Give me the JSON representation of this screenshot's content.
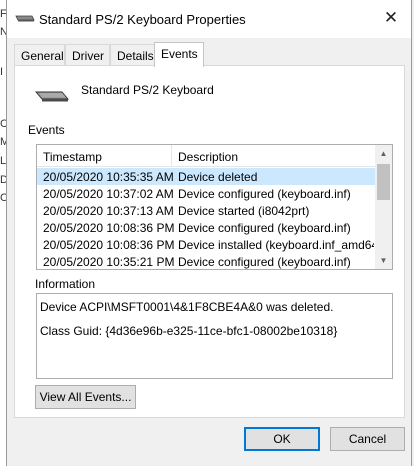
{
  "dialog": {
    "title": "Standard PS/2 Keyboard Properties",
    "close_glyph": "✕"
  },
  "tabs": [
    {
      "label": "General",
      "active": false
    },
    {
      "label": "Driver",
      "active": false
    },
    {
      "label": "Details",
      "active": false
    },
    {
      "label": "Events",
      "active": true
    }
  ],
  "device": {
    "name": "Standard PS/2 Keyboard",
    "icon": "keyboard-icon"
  },
  "events": {
    "section_label": "Events",
    "columns": [
      "Timestamp",
      "Description"
    ],
    "rows": [
      {
        "timestamp": "20/05/2020 10:35:35 AM",
        "description": "Device deleted",
        "selected": true
      },
      {
        "timestamp": "20/05/2020 10:37:02 AM",
        "description": "Device configured (keyboard.inf)",
        "selected": false
      },
      {
        "timestamp": "20/05/2020 10:37:13 AM",
        "description": "Device started (i8042prt)",
        "selected": false
      },
      {
        "timestamp": "20/05/2020 10:08:36 PM",
        "description": "Device configured (keyboard.inf)",
        "selected": false
      },
      {
        "timestamp": "20/05/2020 10:08:36 PM",
        "description": "Device installed (keyboard.inf_amd64...",
        "selected": false
      },
      {
        "timestamp": "20/05/2020 10:35:21 PM",
        "description": "Device configured (keyboard.inf)",
        "selected": false
      }
    ]
  },
  "information": {
    "section_label": "Information",
    "lines": [
      "Device ACPI\\MSFT0001\\4&1F8CBE4A&0 was deleted.",
      "Class Guid: {4d36e96b-e325-11ce-bfc1-08002be10318}"
    ]
  },
  "buttons": {
    "view_all": "View All Events...",
    "ok": "OK",
    "cancel": "Cancel"
  },
  "background_window": {
    "glyphs": [
      "F",
      "N",
      "I",
      "C",
      "M",
      "L",
      "D",
      "C"
    ]
  },
  "colors": {
    "selection": "#cce8ff",
    "default_button_border": "#0078d7"
  }
}
